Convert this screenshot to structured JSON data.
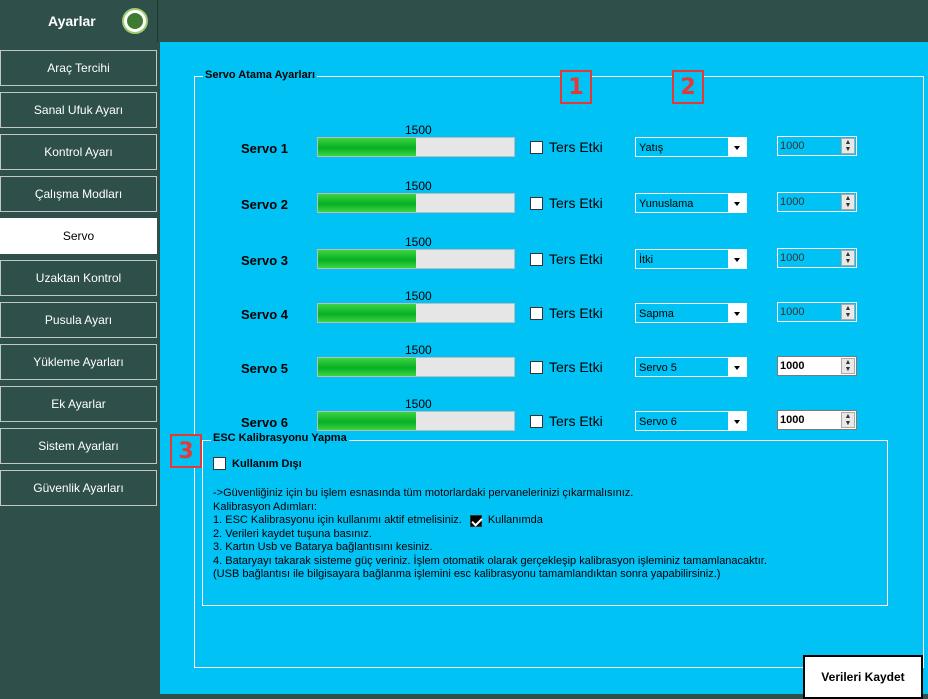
{
  "header": {
    "title": "Ayarlar",
    "logo_icon": "drone-logo-icon"
  },
  "sidebar": {
    "items": [
      {
        "label": "Araç Tercihi",
        "active": false
      },
      {
        "label": "Sanal Ufuk Ayarı",
        "active": false
      },
      {
        "label": "Kontrol Ayarı",
        "active": false
      },
      {
        "label": "Çalışma Modları",
        "active": false
      },
      {
        "label": "Servo",
        "active": true
      },
      {
        "label": "Uzaktan Kontrol",
        "active": false
      },
      {
        "label": "Pusula Ayarı",
        "active": false
      },
      {
        "label": "Yükleme Ayarları",
        "active": false
      },
      {
        "label": "Ek Ayarlar",
        "active": false
      },
      {
        "label": "Sistem Ayarları",
        "active": false
      },
      {
        "label": "Güvenlik Ayarları",
        "active": false
      }
    ]
  },
  "servo_group": {
    "title": "Servo Atama Ayarları",
    "rows": [
      {
        "label": "Servo 1",
        "value": "1500",
        "fill": 0.5,
        "reverse_label": "Ters Etki",
        "reverse_checked": false,
        "assignment": "Yatış",
        "spinner": "1000",
        "spinner_enabled": false
      },
      {
        "label": "Servo 2",
        "value": "1500",
        "fill": 0.5,
        "reverse_label": "Ters Etki",
        "reverse_checked": false,
        "assignment": "Yunuslama",
        "spinner": "1000",
        "spinner_enabled": false
      },
      {
        "label": "Servo 3",
        "value": "1500",
        "fill": 0.5,
        "reverse_label": "Ters Etki",
        "reverse_checked": false,
        "assignment": "İtki",
        "spinner": "1000",
        "spinner_enabled": false
      },
      {
        "label": "Servo 4",
        "value": "1500",
        "fill": 0.5,
        "reverse_label": "Ters Etki",
        "reverse_checked": false,
        "assignment": "Sapma",
        "spinner": "1000",
        "spinner_enabled": false
      },
      {
        "label": "Servo 5",
        "value": "1500",
        "fill": 0.5,
        "reverse_label": "Ters Etki",
        "reverse_checked": false,
        "assignment": "Servo 5",
        "spinner": "1000",
        "spinner_enabled": true
      },
      {
        "label": "Servo 6",
        "value": "1500",
        "fill": 0.5,
        "reverse_label": "Ters Etki",
        "reverse_checked": false,
        "assignment": "Servo 6",
        "spinner": "1000",
        "spinner_enabled": true
      }
    ]
  },
  "markers": [
    "1",
    "2",
    "3"
  ],
  "esc_group": {
    "title": "ESC Kalibrasyonu Yapma",
    "disable_label": "Kullanım Dışı",
    "disable_checked": false,
    "instructions": [
      "->Güvenliğiniz için bu işlem esnasında tüm motorlardaki pervanelerinizi çıkarmalısınız.",
      "Kalibrasyon Adımları:",
      "1. ESC Kalibrasyonu için kullanımı aktif etmelisiniz.",
      "2. Verileri kaydet tuşuna basınız.",
      "3. Kartın Usb ve Batarya bağlantısını kesiniz.",
      "4. Bataryayı takarak sisteme güç veriniz. İşlem otomatik olarak gerçekleşip kalibrasyon işleminiz tamamlanacaktır.",
      "(USB bağlantısı ile bilgisayara bağlanma işlemini esc kalibrasyonu tamamlandıktan sonra yapabilirsiniz.)"
    ],
    "inline_check_label": "Kullanımda",
    "inline_check_checked": true
  },
  "save_button": {
    "label": "Verileri Kaydet"
  },
  "colors": {
    "panel": "#00c2f5",
    "sidebar": "#2f4f4a",
    "bar_fill": "#06b025",
    "marker": "#e53935"
  }
}
